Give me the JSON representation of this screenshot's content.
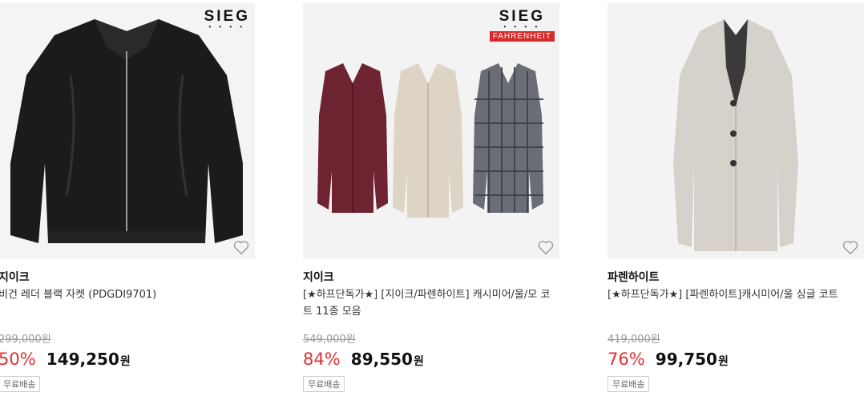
{
  "products": [
    {
      "logo": {
        "main": "SIEG",
        "sub": ""
      },
      "brand": "지이크",
      "title": "비건 레더 블랙 자켓 (PDGDI9701)",
      "original_price": "299,000원",
      "discount_rate": "50%",
      "sale_price": "149,250",
      "currency": "원",
      "shipping_badge": "무료배송"
    },
    {
      "logo": {
        "main": "SIEG",
        "sub": "FAHRENHEIT"
      },
      "brand": "지이크",
      "title": "[★하프단독가★] [지이크/파렌하이트] 캐시미어/울/모 코트 11종 모음",
      "original_price": "549,000원",
      "discount_rate": "84%",
      "sale_price": "89,550",
      "currency": "원",
      "shipping_badge": "무료배송"
    },
    {
      "logo": {
        "main": "",
        "sub": ""
      },
      "brand": "파렌하이트",
      "title": "[★하프단독가★] [파렌하이트]캐시미어/울 싱글 코트",
      "original_price": "419,000원",
      "discount_rate": "76%",
      "sale_price": "99,750",
      "currency": "원",
      "shipping_badge": "무료배송"
    }
  ],
  "icons": {
    "wishlist": "heart-outline-icon"
  },
  "colors": {
    "discount": "#e03131",
    "logo_bar": "#d52b2b"
  }
}
